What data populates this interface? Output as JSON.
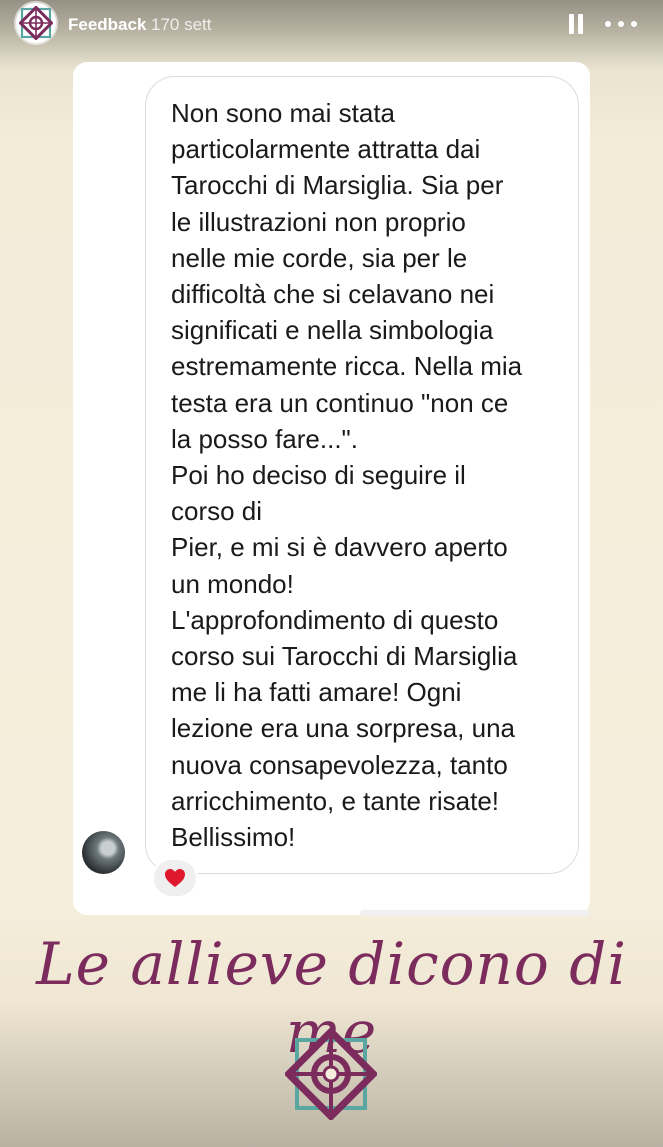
{
  "header": {
    "account_name": "Feedback",
    "time_ago": "170 sett",
    "pause_icon": "pause-icon",
    "more_icon": "more-horizontal-icon"
  },
  "message": {
    "lines": [
      "Non sono mai stata",
      "particolarmente attratta dai",
      "Tarocchi di Marsiglia. Sia per",
      "le illustrazioni non proprio",
      "nelle mie corde, sia per le",
      "difficoltà che si celavano nei",
      "significati e nella simbologia",
      "estremamente ricca. Nella mia",
      "testa era un continuo \"non ce",
      "la posso fare...\".",
      "Poi ho deciso di seguire il",
      "corso di",
      "Pier, e mi si è davvero aperto",
      "un mondo!",
      "L'approfondimento di questo",
      "corso sui Tarocchi di Marsiglia",
      "me li ha fatti amare! Ogni",
      "lezione era una sorpresa, una",
      "nuova consapevolezza, tanto",
      "arricchimento, e tante risate!",
      "Bellissimo!"
    ],
    "reaction": "❤️"
  },
  "caption": "Le allieve dicono di me",
  "colors": {
    "brand_plum": "#7b2c5d",
    "brand_teal": "#5aa6a1"
  }
}
